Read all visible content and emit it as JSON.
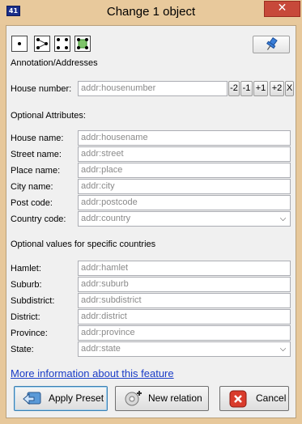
{
  "window": {
    "title": "Change 1 object",
    "app_icon_text": "41",
    "close_glyph": "✕"
  },
  "preset_type_icons": [
    "node-icon",
    "way-icon",
    "closed-way-icon",
    "multipolygon-icon"
  ],
  "preset_group": "Annotation/Addresses",
  "house_number": {
    "label": "House number:",
    "placeholder": "addr:housenumber",
    "buttons": [
      "-2",
      "-1",
      "+1",
      "+2",
      "X"
    ]
  },
  "optional_attributes": {
    "heading": "Optional Attributes:",
    "fields": [
      {
        "label": "House name:",
        "placeholder": "addr:housename"
      },
      {
        "label": "Street name:",
        "placeholder": "addr:street"
      },
      {
        "label": "Place name:",
        "placeholder": "addr:place"
      },
      {
        "label": "City name:",
        "placeholder": "addr:city"
      },
      {
        "label": "Post code:",
        "placeholder": "addr:postcode"
      },
      {
        "label": "Country code:",
        "placeholder": "addr:country"
      }
    ]
  },
  "country_specific": {
    "heading": "Optional values for specific countries",
    "fields": [
      {
        "label": "Hamlet:",
        "placeholder": "addr:hamlet"
      },
      {
        "label": "Suburb:",
        "placeholder": "addr:suburb"
      },
      {
        "label": "Subdistrict:",
        "placeholder": "addr:subdistrict"
      },
      {
        "label": "District:",
        "placeholder": "addr:district"
      },
      {
        "label": "Province:",
        "placeholder": "addr:province"
      },
      {
        "label": "State:",
        "placeholder": "addr:state"
      }
    ]
  },
  "more_info_link": "More information about this feature",
  "buttons": {
    "apply": "Apply Preset",
    "new_relation": "New relation",
    "cancel": "Cancel"
  },
  "colors": {
    "title_bar": "#e8c99c",
    "close_button": "#c7493a",
    "link": "#1a3cc7",
    "dialog_bg": "#f0f0f0"
  }
}
